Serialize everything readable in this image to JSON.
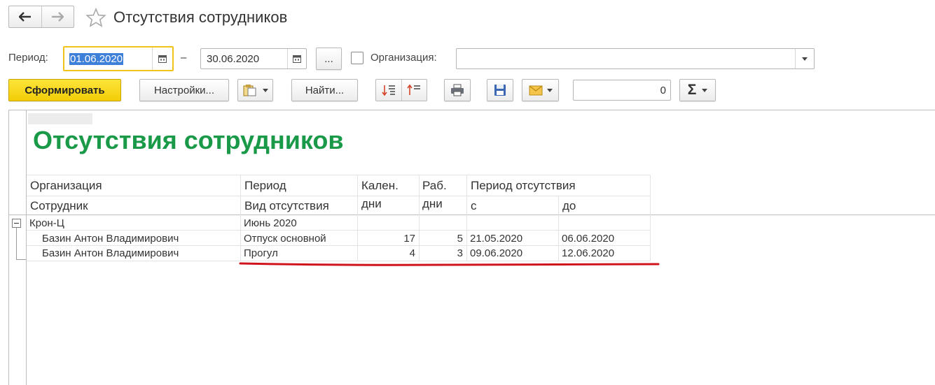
{
  "window": {
    "title": "Отсутствия сотрудников"
  },
  "params": {
    "period_label": "Период:",
    "date_from": "01.06.2020",
    "dash": "–",
    "date_to": "30.06.2020",
    "more_label": "...",
    "org_label": "Организация:",
    "org_value": "",
    "org_checked": false
  },
  "toolbar": {
    "generate_label": "Сформировать",
    "settings_label": "Настройки...",
    "find_label": "Найти...",
    "sum_value": "0"
  },
  "report": {
    "title": "Отсутствия сотрудников",
    "headers": {
      "org": "Организация",
      "employee": "Сотрудник",
      "period": "Период",
      "absence_type": "Вид отсутствия",
      "cal_days_1": "Кален.",
      "cal_days_2": "дни",
      "work_days_1": "Раб.",
      "work_days_2": "дни",
      "absence_period": "Период отсутствия",
      "from": "с",
      "to": "до"
    },
    "group": {
      "org": "Крон-Ц",
      "period": "Июнь 2020"
    },
    "rows": [
      {
        "employee": "Базин Антон Владимирович",
        "type": "Отпуск основной",
        "cal": "17",
        "work": "5",
        "from": "21.05.2020",
        "to": "06.06.2020"
      },
      {
        "employee": "Базин Антон Владимирович",
        "type": "Прогул",
        "cal": "4",
        "work": "3",
        "from": "09.06.2020",
        "to": "12.06.2020"
      }
    ]
  },
  "colors": {
    "title_green": "#1a9a48",
    "accent_yellow": "#f5d40f",
    "underline_red": "#d0141e",
    "focus_border": "#f0c419"
  }
}
